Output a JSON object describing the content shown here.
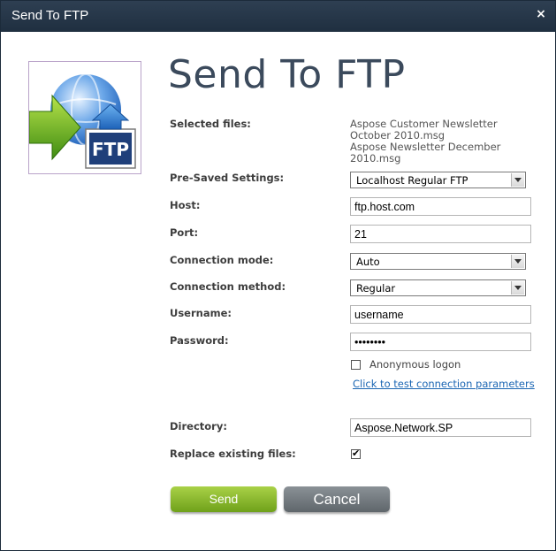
{
  "window": {
    "title": "Send To FTP",
    "close_glyph": "×"
  },
  "heading": "Send To FTP",
  "logo": {
    "icon": "ftp-globe-icon",
    "badge_text": "FTP"
  },
  "labels": {
    "selected_files": "Selected files:",
    "presaved": "Pre-Saved Settings:",
    "host": "Host:",
    "port": "Port:",
    "connection_mode": "Connection mode:",
    "connection_method": "Connection method:",
    "username": "Username:",
    "password": "Password:",
    "directory": "Directory:",
    "replace": "Replace existing files:"
  },
  "selected_files": [
    "Aspose Customer Newsletter October 2010.msg",
    "Aspose Newsletter December 2010.msg"
  ],
  "fields": {
    "presaved": "Localhost Regular FTP",
    "host": "ftp.host.com",
    "port": "21",
    "connection_mode": "Auto",
    "connection_method": "Regular",
    "username": "username",
    "password": "••••••••",
    "directory": "Aspose.Network.SP"
  },
  "anonymous": {
    "label": "Anonymous logon",
    "checked": false
  },
  "test_link": "Click to test connection parameters",
  "replace_existing": {
    "checked": true
  },
  "buttons": {
    "send": "Send",
    "cancel": "Cancel"
  },
  "colors": {
    "titlebar": "#243446",
    "heading": "#3b4a5c",
    "send_button": "#8bbb2c",
    "cancel_button": "#6f767b",
    "link": "#1b66b3"
  }
}
